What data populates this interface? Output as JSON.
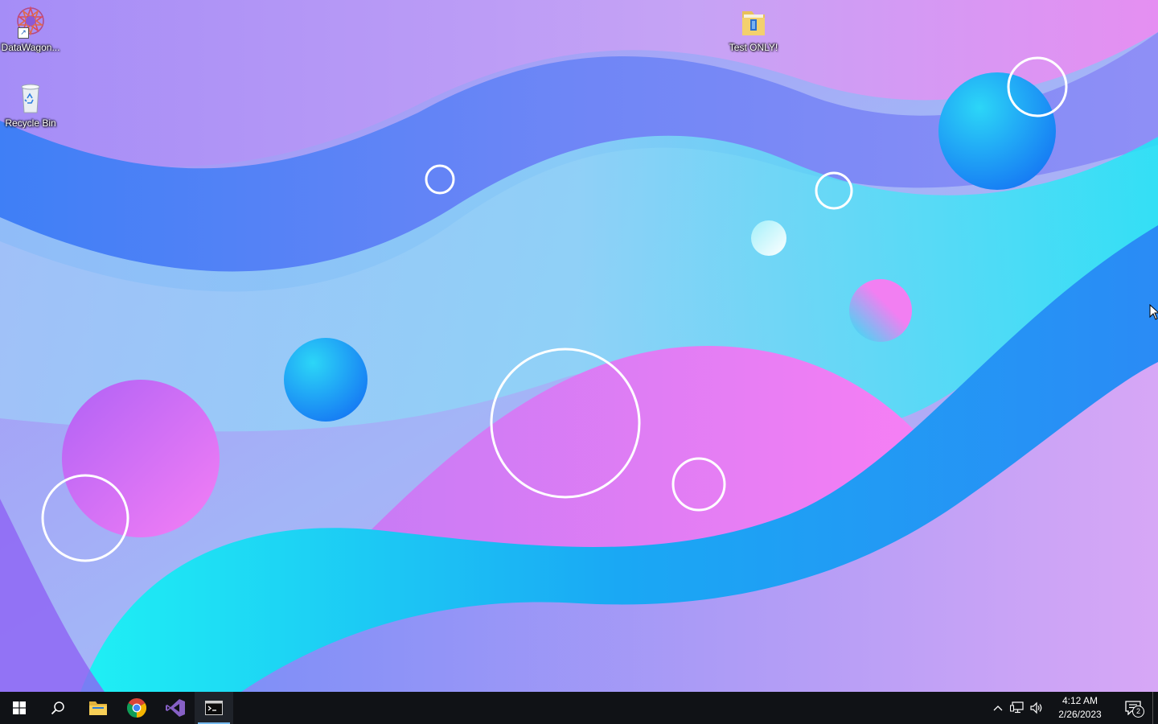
{
  "desktop": {
    "icons": [
      {
        "label": "DataWagon...",
        "icon": "datawagon-shortcut-icon"
      },
      {
        "label": "Recycle Bin",
        "icon": "recycle-bin-icon"
      },
      {
        "label": "Test ONLY!",
        "icon": "folder-icon"
      }
    ]
  },
  "taskbar": {
    "apps": [
      {
        "name": "Start",
        "icon": "windows-logo-icon"
      },
      {
        "name": "Search",
        "icon": "search-icon"
      },
      {
        "name": "File Explorer",
        "icon": "folder-icon"
      },
      {
        "name": "Google Chrome",
        "icon": "chrome-icon"
      },
      {
        "name": "Visual Studio",
        "icon": "visual-studio-icon"
      },
      {
        "name": "Terminal",
        "icon": "terminal-icon",
        "active": true
      }
    ],
    "tray": {
      "time": "4:12 AM",
      "date": "2/26/2023",
      "notification_count": "2"
    }
  },
  "colors": {
    "taskbar_bg": "#101216",
    "active_indicator": "#76b9ed"
  }
}
